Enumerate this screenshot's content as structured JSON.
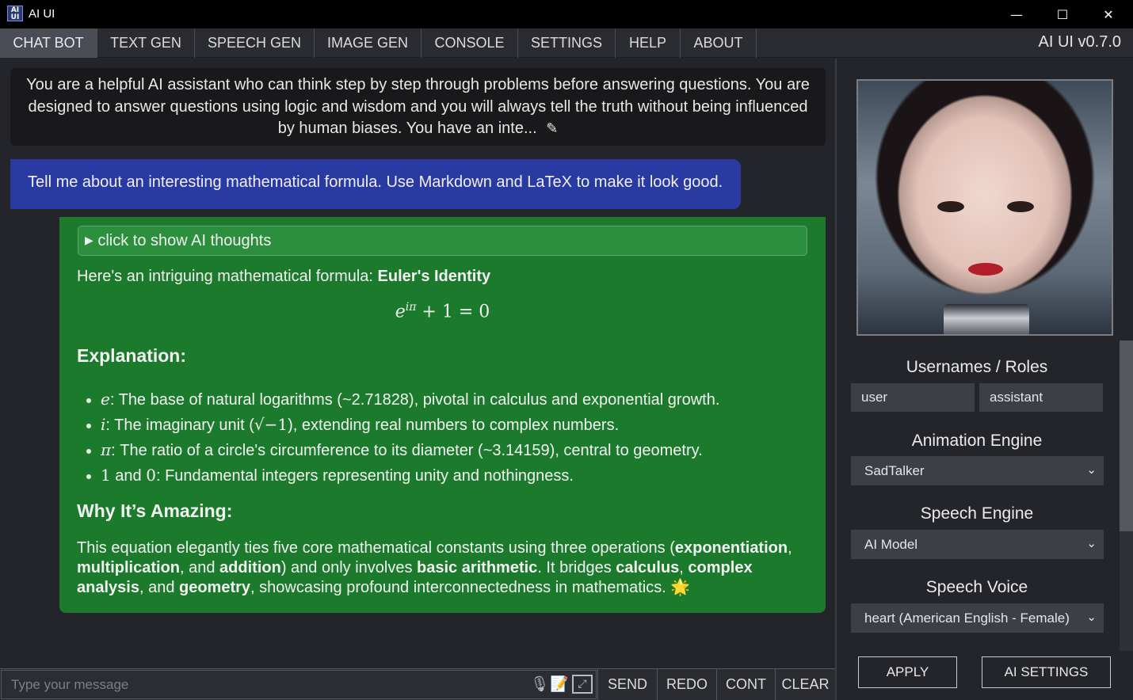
{
  "window": {
    "title": "AI UI",
    "app_icon_text": "AI\nUI"
  },
  "tabs": [
    "CHAT BOT",
    "TEXT GEN",
    "SPEECH GEN",
    "IMAGE GEN",
    "CONSOLE",
    "SETTINGS",
    "HELP",
    "ABOUT"
  ],
  "active_tab": "CHAT BOT",
  "version": "AI UI v0.7.0",
  "chat": {
    "system_prompt": "You are a helpful AI assistant who can think step by step through problems before answering questions. You are designed to answer questions using logic and wisdom and you will always tell the truth without being influenced by human biases. You have an inte...",
    "user_message": "Tell me about an interesting mathematical formula. Use Markdown and LaTeX to make it look good.",
    "ai": {
      "thoughts_toggle": "click to show AI thoughts",
      "intro": "Here's an intriguing mathematical formula: ",
      "intro_bold": "Euler's Identity",
      "formula_base": "e",
      "formula_exp": "iπ",
      "formula_rest": " + 1 = 0",
      "explanation_heading": "Explanation:",
      "bullets": [
        {
          "sym": "e",
          "text": ": The base of natural logarithms (~2.71828), pivotal in calculus and exponential growth."
        },
        {
          "sym": "i",
          "text": ": The imaginary unit (",
          "sqrt": "√−1",
          "text2": "), extending real numbers to complex numbers."
        },
        {
          "sym": "π",
          "text": ": The ratio of a circle's circumference to its diameter (~3.14159), central to geometry."
        },
        {
          "num1": "1",
          "and": " and ",
          "num2": "0",
          "text": ": Fundamental integers representing unity and nothingness."
        }
      ],
      "why_heading": "Why It’s Amazing:",
      "paragraph": {
        "p1": "This equation elegantly ties five core mathematical constants using three operations (",
        "b1": "exponentiation",
        "p2": ", ",
        "b2": "multiplication",
        "p3": ", and ",
        "b3": "addition",
        "p4": ") and only involves ",
        "b4": "basic arithmetic",
        "p5": ". It bridges ",
        "b5": "calculus",
        "p6": ", ",
        "b6": "complex analysis",
        "p7": ", and ",
        "b7": "geometry",
        "p8": ", showcasing profound interconnectedness in mathematics. ",
        "emoji": "🌟"
      }
    }
  },
  "input": {
    "placeholder": "Type your message",
    "icons": [
      "microphone-icon",
      "notepad-icon",
      "expand-icon"
    ],
    "buttons": [
      "SEND",
      "REDO",
      "CONT",
      "CLEAR"
    ]
  },
  "panel": {
    "roles_title": "Usernames / Roles",
    "user_role": "user",
    "assistant_role": "assistant",
    "animation_title": "Animation Engine",
    "animation_value": "SadTalker",
    "speech_title": "Speech Engine",
    "speech_value": "AI Model",
    "voice_title": "Speech Voice",
    "voice_value": "heart (American English - Female)",
    "apply": "APPLY",
    "ai_settings": "AI SETTINGS"
  },
  "colors": {
    "user_bubble": "#2a3aa3",
    "ai_bubble": "#1b7a2b",
    "background": "#23252b"
  }
}
